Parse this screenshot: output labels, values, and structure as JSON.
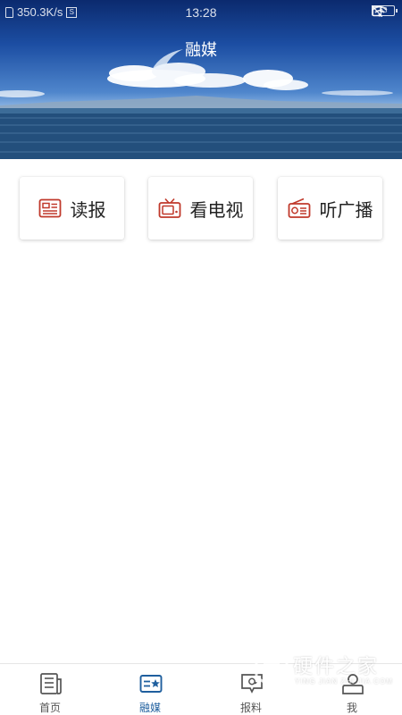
{
  "status_bar": {
    "network_speed": "350.3K/s",
    "time": "13:28",
    "s_badge": "S",
    "battery_label": "63"
  },
  "hero": {
    "title": "融媒"
  },
  "entries": [
    {
      "label": "读报",
      "icon": "newspaper-icon"
    },
    {
      "label": "看电视",
      "icon": "tv-icon"
    },
    {
      "label": "听广播",
      "icon": "radio-icon"
    }
  ],
  "tabs": [
    {
      "label": "首页",
      "icon": "news-list-icon",
      "active": false
    },
    {
      "label": "融媒",
      "icon": "media-card-icon",
      "active": true
    },
    {
      "label": "报料",
      "icon": "report-chat-icon",
      "active": false
    },
    {
      "label": "我",
      "icon": "person-icon",
      "active": false
    }
  ],
  "watermark": {
    "text": "硬件之家",
    "sub": "YING JIAN ZHI JIA.COM"
  },
  "colors": {
    "accent": "#1f5f9e",
    "entry_icon": "#c0392b",
    "tab_inactive": "#555555"
  }
}
